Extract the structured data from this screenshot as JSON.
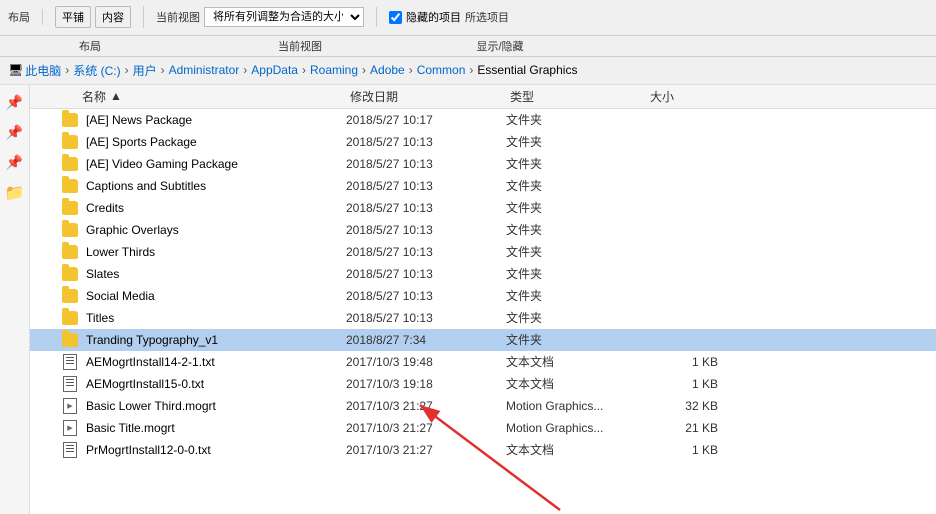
{
  "toolbar": {
    "layout_label": "布局",
    "view_label": "当前视图",
    "showhide_label": "显示/隐藏",
    "layout_options": [
      "平铺",
      "内容"
    ],
    "checkbox_label": "隐藏的项目",
    "checkbox2_label": "所选项目"
  },
  "breadcrumb": {
    "items": [
      {
        "label": "此电脑",
        "sep": "›"
      },
      {
        "label": "系统 (C:)",
        "sep": "›"
      },
      {
        "label": "用户",
        "sep": "›"
      },
      {
        "label": "Administrator",
        "sep": "›"
      },
      {
        "label": "AppData",
        "sep": "›"
      },
      {
        "label": "Roaming",
        "sep": "›"
      },
      {
        "label": "Adobe",
        "sep": "›"
      },
      {
        "label": "Common",
        "sep": "›"
      },
      {
        "label": "Essential Graphics",
        "sep": ""
      }
    ]
  },
  "columns": {
    "name": "名称",
    "date": "修改日期",
    "type": "类型",
    "size": "大小"
  },
  "files": [
    {
      "name": "[AE] News Package",
      "date": "2018/5/27 10:17",
      "type": "文件夹",
      "size": "",
      "kind": "folder",
      "selected": false
    },
    {
      "name": "[AE] Sports Package",
      "date": "2018/5/27 10:13",
      "type": "文件夹",
      "size": "",
      "kind": "folder",
      "selected": false
    },
    {
      "name": "[AE] Video Gaming Package",
      "date": "2018/5/27 10:13",
      "type": "文件夹",
      "size": "",
      "kind": "folder",
      "selected": false
    },
    {
      "name": "Captions and Subtitles",
      "date": "2018/5/27 10:13",
      "type": "文件夹",
      "size": "",
      "kind": "folder",
      "selected": false
    },
    {
      "name": "Credits",
      "date": "2018/5/27 10:13",
      "type": "文件夹",
      "size": "",
      "kind": "folder",
      "selected": false
    },
    {
      "name": "Graphic Overlays",
      "date": "2018/5/27 10:13",
      "type": "文件夹",
      "size": "",
      "kind": "folder",
      "selected": false
    },
    {
      "name": "Lower Thirds",
      "date": "2018/5/27 10:13",
      "type": "文件夹",
      "size": "",
      "kind": "folder",
      "selected": false
    },
    {
      "name": "Slates",
      "date": "2018/5/27 10:13",
      "type": "文件夹",
      "size": "",
      "kind": "folder",
      "selected": false
    },
    {
      "name": "Social Media",
      "date": "2018/5/27 10:13",
      "type": "文件夹",
      "size": "",
      "kind": "folder",
      "selected": false
    },
    {
      "name": "Titles",
      "date": "2018/5/27 10:13",
      "type": "文件夹",
      "size": "",
      "kind": "folder",
      "selected": false
    },
    {
      "name": "Tranding Typography_v1",
      "date": "2018/8/27 7:34",
      "type": "文件夹",
      "size": "",
      "kind": "folder",
      "selected": true
    },
    {
      "name": "AEMogrtInstall14-2-1.txt",
      "date": "2017/10/3 19:48",
      "type": "文本文档",
      "size": "1 KB",
      "kind": "txt",
      "selected": false
    },
    {
      "name": "AEMogrtInstall15-0.txt",
      "date": "2017/10/3 19:18",
      "type": "文本文档",
      "size": "1 KB",
      "kind": "txt",
      "selected": false
    },
    {
      "name": "Basic Lower Third.mogrt",
      "date": "2017/10/3 21:27",
      "type": "Motion Graphics...",
      "size": "32 KB",
      "kind": "mogrt",
      "selected": false
    },
    {
      "name": "Basic Title.mogrt",
      "date": "2017/10/3 21:27",
      "type": "Motion Graphics...",
      "size": "21 KB",
      "kind": "mogrt",
      "selected": false
    },
    {
      "name": "PrMogrtInstall12-0-0.txt",
      "date": "2017/10/3 21:27",
      "type": "文本文档",
      "size": "1 KB",
      "kind": "txt",
      "selected": false
    }
  ],
  "sidebar_icons": [
    "📌",
    "📌",
    "📌",
    "📁"
  ],
  "arrow": {
    "color": "#e03030"
  }
}
